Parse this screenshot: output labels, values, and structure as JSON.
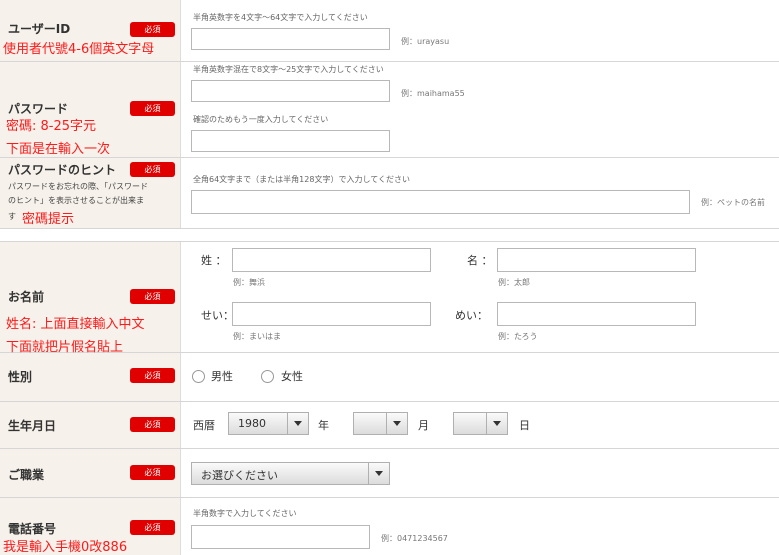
{
  "required_badge": "必須",
  "user_id": {
    "title": "ユーザーID",
    "note": "使用者代號4-6個英文字母",
    "help": "半角英数字を4文字～64文字で入力してください",
    "example": "例：urayasu"
  },
  "password": {
    "title": "パスワード",
    "note1": "密碼: 8-25字元",
    "note2": "下面是在輸入一次",
    "help": "半角英数字混在で8文字～25文字で入力してください",
    "example": "例：maihama55",
    "confirm_help": "確認のためもう一度入力してください"
  },
  "hint": {
    "title": "パスワードのヒント",
    "desc1": "パスワードをお忘れの際、「パスワード",
    "desc2": "のヒント」を表示させることが出来ま",
    "desc3": "す",
    "note": "密碼提示",
    "help": "全角64文字まで（または半角128文字）で入力してください",
    "example": "例：ペットの名前"
  },
  "name": {
    "title": "お名前",
    "note1": "姓名: 上面直接輸入中文",
    "note2": "下面就把片假名貼上",
    "sei_label": "姓 ：",
    "mei_label": "名 ：",
    "sei_example": "例：舞浜",
    "mei_example": "例：太郎",
    "sei_kana_label": "せい：",
    "mei_kana_label": "めい：",
    "sei_kana_example": "例：まいはま",
    "mei_kana_example": "例：たろう"
  },
  "gender": {
    "title": "性別",
    "male": "男性",
    "female": "女性"
  },
  "birthday": {
    "title": "生年月日",
    "era": "西暦",
    "year_value": "1980",
    "year_unit": "年",
    "month_value": "",
    "month_unit": "月",
    "day_value": "",
    "day_unit": "日"
  },
  "occupation": {
    "title": "ご職業",
    "selected": "お選びください"
  },
  "phone": {
    "title": "電話番号",
    "note": "我是輸入手機0改886",
    "help": "半角数字で入力してください",
    "example": "例：0471234567"
  }
}
